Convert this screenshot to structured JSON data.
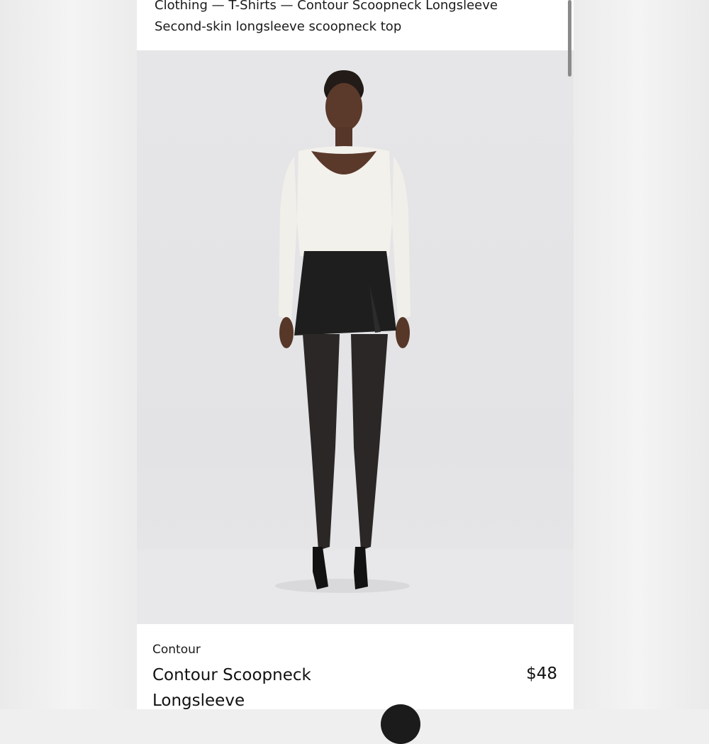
{
  "header": {
    "breadcrumb": "Clothing — T-Shirts — Contour Scoopneck Longsleeve",
    "tagline": "Second-skin longsleeve scoopneck top"
  },
  "product_image": {
    "alt": "Model wearing a white scoopneck longsleeve top with a black mini skirt, sheer black tights and black heels"
  },
  "product": {
    "brand": "Contour",
    "title": "Contour Scoopneck Longsleeve",
    "price": "$48"
  },
  "colors": {
    "top": "#f3f1ec",
    "skirt": "#1e1e1e",
    "tights": "#2a2726",
    "skin": "#5b3a2b",
    "backdrop": "#e4e4e6"
  }
}
